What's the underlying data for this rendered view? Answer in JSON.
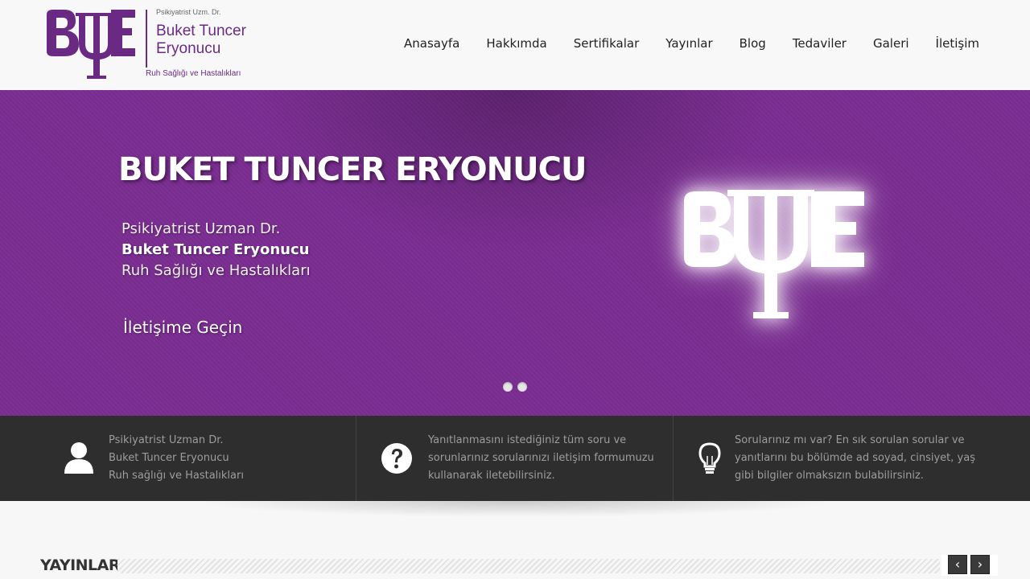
{
  "logo": {
    "small": "Psikiyatrist Uzm. Dr.",
    "name_line1": "Buket Tuncer",
    "name_line2": "Eryonucu",
    "subtitle": "Ruh Sağlığı ve Hastalıkları",
    "mark_text": "BΨE",
    "color": "#6a2a84"
  },
  "nav": {
    "items": [
      {
        "label": "Anasayfa"
      },
      {
        "label": "Hakkımda"
      },
      {
        "label": "Sertifikalar"
      },
      {
        "label": "Yayınlar"
      },
      {
        "label": "Blog"
      },
      {
        "label": "Tedaviler"
      },
      {
        "label": "Galeri"
      },
      {
        "label": "İletişim"
      }
    ]
  },
  "hero": {
    "title": "BUKET TUNCER ERYONUCU",
    "line1": "Psikiyatrist Uzman Dr.",
    "line2": "Buket Tuncer Eryonucu",
    "line3": "Ruh Sağlığı ve Hastalıkları",
    "cta": "İletişime Geçin",
    "background": "#7b2d92",
    "slide_count": 2
  },
  "info": [
    {
      "icon": "user-icon",
      "lines": [
        "Psikiyatrist Uzman Dr.",
        "Buket Tuncer Eryonucu",
        "Ruh sağlığı ve Hastalıkları"
      ]
    },
    {
      "icon": "question-icon",
      "lines": [
        "Yanıtlanmasını istediğiniz tüm soru ve",
        "sorunlarınız sorularınızı iletişim formumuzu",
        "kullanarak iletebilirsiniz."
      ]
    },
    {
      "icon": "lightbulb-icon",
      "lines": [
        "Sorularınız mı var? En sık sorulan sorular ve",
        "yanıtlarını bu bölümde ad soyad, cinsiyet, yaş",
        "gibi bilgiler olmaksızın bulabilirsiniz."
      ]
    }
  ],
  "section": {
    "title": "YAYINLAR",
    "prev": "‹",
    "next": "›"
  }
}
